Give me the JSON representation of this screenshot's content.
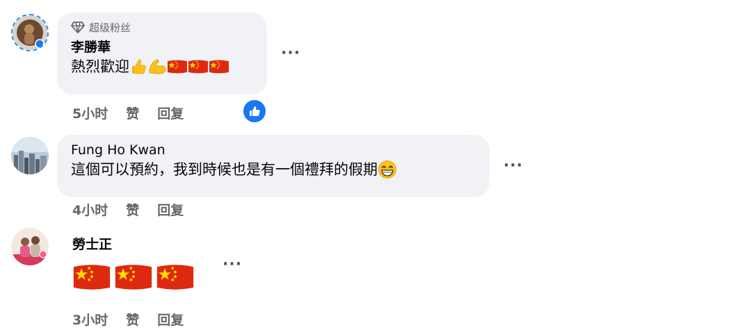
{
  "comments": [
    {
      "badge": "超级粉丝",
      "author": "李勝華",
      "text": "熱烈歡迎",
      "emojis": [
        "thumbs-up-emoji",
        "flexed-biceps-emoji",
        "china-flag-emoji",
        "china-flag-emoji",
        "china-flag-emoji"
      ],
      "time": "5小时",
      "like_label": "赞",
      "reply_label": "回复",
      "reaction": "like-reaction-icon"
    },
    {
      "author": "Fung Ho Kwan",
      "text": "這個可以預約，我到時候也是有一個禮拜的假期",
      "emojis": [
        "grinning-emoji"
      ],
      "time": "4小时",
      "like_label": "赞",
      "reply_label": "回复"
    },
    {
      "author": "勞士正",
      "emojis": [
        "china-flag-emoji",
        "china-flag-emoji",
        "china-flag-emoji"
      ],
      "time": "3小时",
      "like_label": "赞",
      "reply_label": "回复"
    }
  ],
  "more_label": "···",
  "colors": {
    "bubble": "#f0f2f5",
    "meta_text": "#65676b",
    "like_blue": "#1877f2",
    "flag_red": "#de2910",
    "flag_star": "#ffde00"
  }
}
